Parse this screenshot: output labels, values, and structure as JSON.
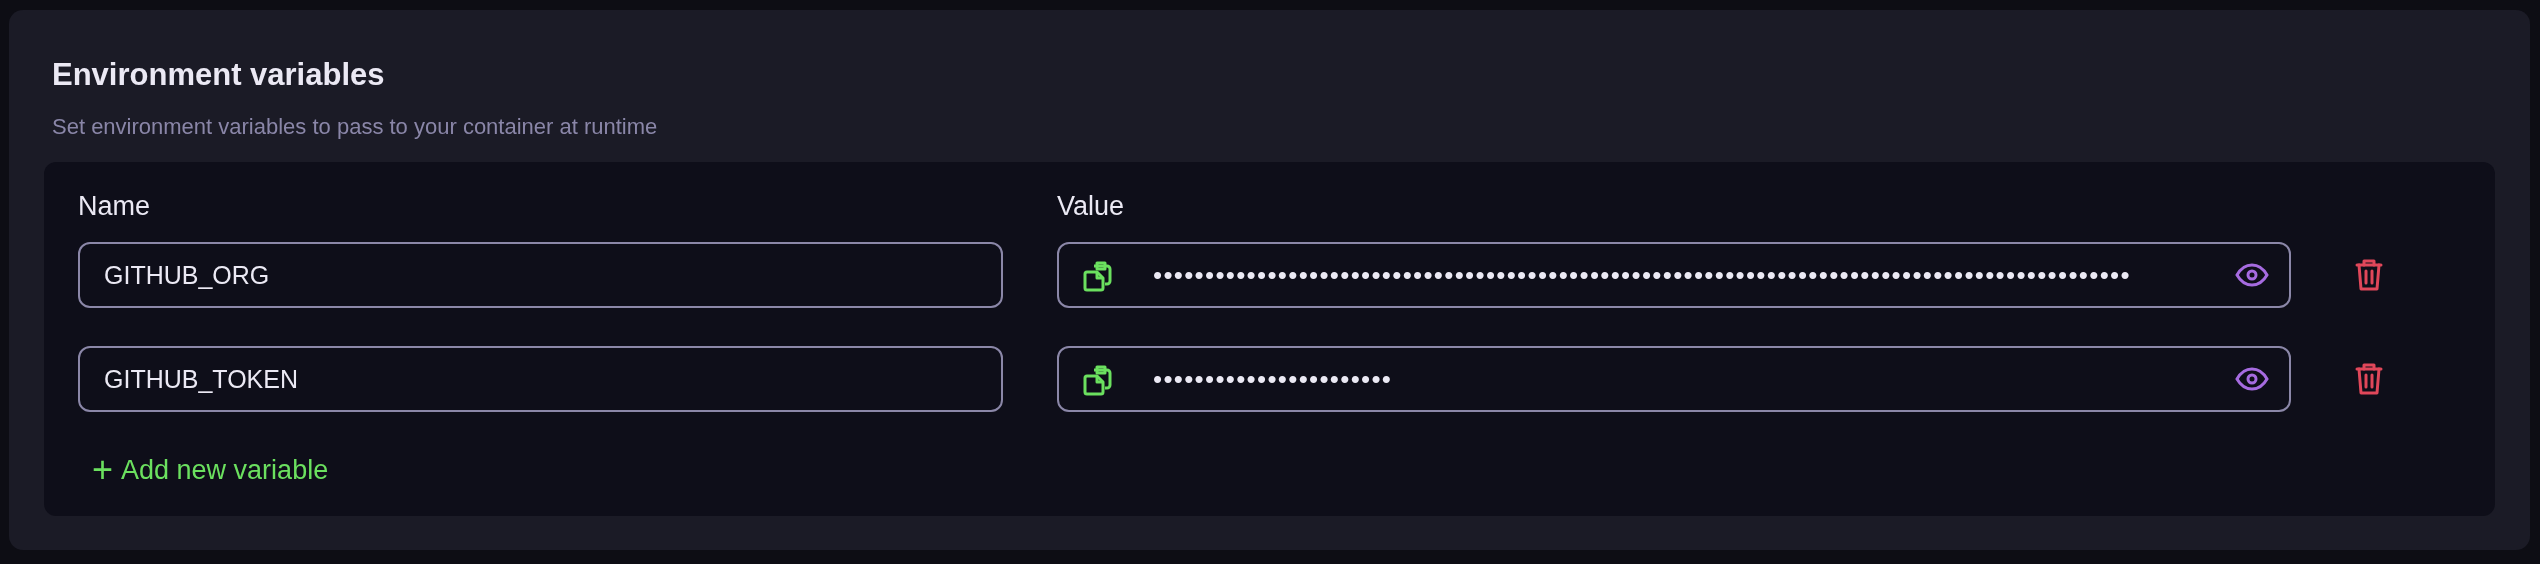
{
  "section": {
    "title": "Environment variables",
    "description": "Set environment variables to pass to your container at runtime"
  },
  "columns": {
    "name": "Name",
    "value": "Value"
  },
  "variables": [
    {
      "name": "GITHUB_ORG",
      "value": "••••••••••••••••••••••••••••••••••••••••••••••••••••••••••••••••••••••••••••••••••••••••••••••"
    },
    {
      "name": "GITHUB_TOKEN",
      "value": "•••••••••••••••••••••••"
    }
  ],
  "add_button": {
    "icon": "+",
    "label": "Add new variable"
  }
}
